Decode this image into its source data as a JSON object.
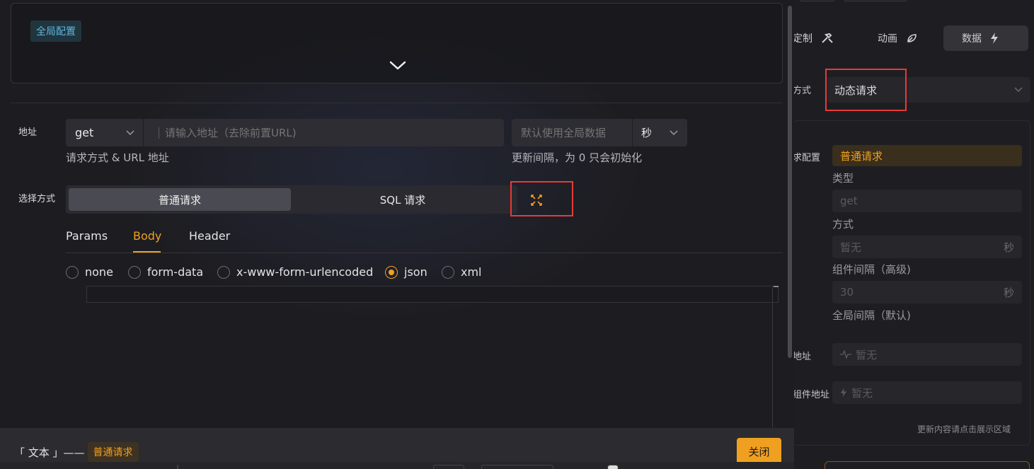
{
  "modal": {
    "global_tag": "全局配置",
    "address": {
      "label": "地址",
      "method_value": "get",
      "url_placeholder": "请输入地址（去除前置URL)",
      "interval_placeholder": "默认使用全局数据",
      "interval_unit": "秒",
      "method_helper": "请求方式 & URL 地址",
      "interval_helper": "更新间隔，为 0 只会初始化"
    },
    "select_mode": {
      "label": "选择方式",
      "options": [
        "普通请求",
        "SQL 请求"
      ]
    },
    "tabs": [
      "Params",
      "Body",
      "Header"
    ],
    "body_types": [
      "none",
      "form-data",
      "x-www-form-urlencoded",
      "json",
      "xml"
    ],
    "footer": {
      "prefix": "「 文本 」——",
      "badge": "普通请求",
      "close_label": "关闭"
    }
  },
  "right_panel": {
    "tabs": [
      {
        "label": "定制",
        "icon": "tools-icon"
      },
      {
        "label": "动画",
        "icon": "leaf-icon"
      },
      {
        "label": "数据",
        "icon": "bolt-icon"
      }
    ],
    "request_mode_label": "方式",
    "request_mode_value": "动态请求",
    "config_label": "求配置",
    "config_badge": "普通请求",
    "type_label": "类型",
    "type_value": "get",
    "mode_label": "方式",
    "mode_value": "暂无",
    "mode_unit": "秒",
    "component_interval_label": "组件间隔（高级)",
    "component_interval_value": "30",
    "component_interval_unit": "秒",
    "global_interval_label": "全局间隔（默认)",
    "addr_label": "地址",
    "addr_value": "暂无",
    "component_addr_label": "组件地址",
    "component_addr_value": "暂无",
    "update_hint": "更新内容请点击展示区域"
  },
  "colors": {
    "accent": "#f0a020",
    "info_tag": "#5fb6e0",
    "highlight_border": "#e83a3a"
  }
}
